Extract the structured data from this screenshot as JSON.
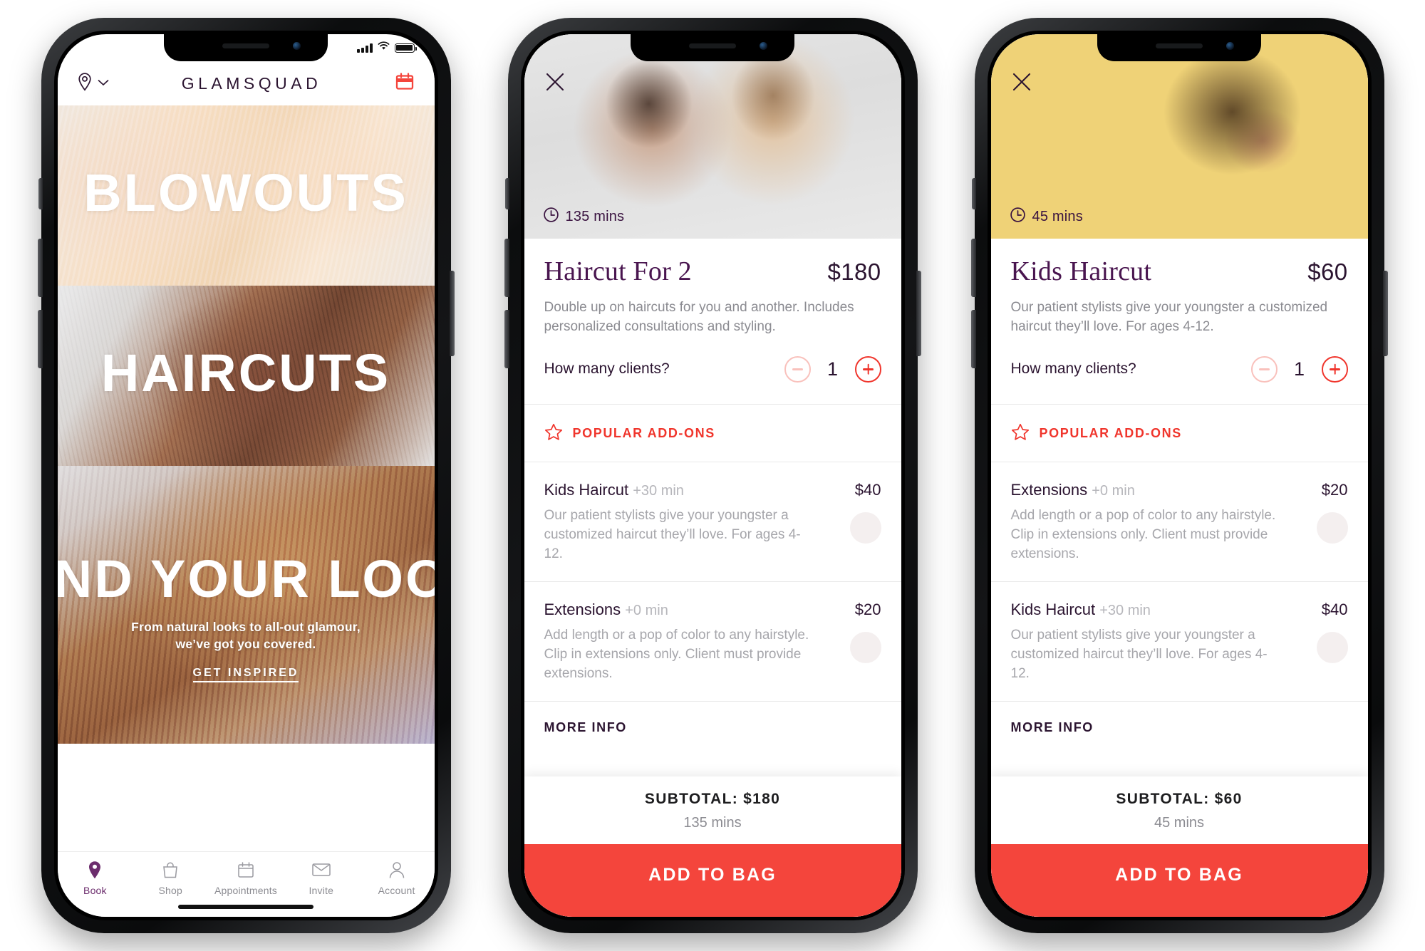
{
  "phone1": {
    "statusbar": {
      "signal_icon": "cellular-signal-icon",
      "wifi_icon": "wifi-icon",
      "battery_icon": "battery-icon"
    },
    "header": {
      "location_icon": "location-pin-icon",
      "location_chevron_icon": "chevron-down-icon",
      "brand": "GLAMSQUAD",
      "calendar_icon": "calendar-icon"
    },
    "heroes": [
      {
        "label": "BLOWOUTS",
        "name": "hero-blowouts"
      },
      {
        "label": "HAIRCUTS",
        "name": "hero-haircuts"
      },
      {
        "label": "FIND YOUR LOOK",
        "name": "hero-find-your-look",
        "subtitle": "From natural looks to all-out glamour,\nwe’ve got you covered.",
        "cta": "GET INSPIRED"
      }
    ],
    "tabbar": [
      {
        "label": "Book",
        "icon": "location-pin-icon",
        "active": true
      },
      {
        "label": "Shop",
        "icon": "shopping-bag-icon",
        "active": false
      },
      {
        "label": "Appointments",
        "icon": "calendar-icon",
        "active": false
      },
      {
        "label": "Invite",
        "icon": "envelope-icon",
        "active": false
      },
      {
        "label": "Account",
        "icon": "person-icon",
        "active": false
      }
    ]
  },
  "phone2": {
    "close_icon": "close-icon",
    "clock_icon": "clock-icon",
    "duration": "135 mins",
    "title": "Haircut For 2",
    "price": "$180",
    "description": "Double up on haircuts for you and another. Includes personalized consultations and styling.",
    "clients_label": "How many clients?",
    "minus_icon": "minus-circle-icon",
    "plus_icon": "plus-circle-icon",
    "quantity": "1",
    "addons_star_icon": "star-icon",
    "addons_heading": "POPULAR ADD-ONS",
    "addons": [
      {
        "name": "Kids Haircut",
        "mins": "+30 min",
        "price": "$40",
        "description": "Our patient stylists give your youngster a customized haircut they’ll love. For ages 4-12."
      },
      {
        "name": "Extensions",
        "mins": "+0 min",
        "price": "$20",
        "description": "Add length or a pop of color to any hairstyle. Clip in extensions only. Client must provide extensions."
      }
    ],
    "more_info": "MORE INFO",
    "subtotal": "SUBTOTAL: $180",
    "subtotal_mins": "135 mins",
    "cta": "ADD TO BAG"
  },
  "phone3": {
    "close_icon": "close-icon",
    "clock_icon": "clock-icon",
    "duration": "45 mins",
    "title": "Kids Haircut",
    "price": "$60",
    "description": "Our patient stylists give your youngster a customized haircut they’ll love. For ages 4-12.",
    "clients_label": "How many clients?",
    "minus_icon": "minus-circle-icon",
    "plus_icon": "plus-circle-icon",
    "quantity": "1",
    "addons_star_icon": "star-icon",
    "addons_heading": "POPULAR ADD-ONS",
    "addons": [
      {
        "name": "Extensions",
        "mins": "+0 min",
        "price": "$20",
        "description": "Add length or a pop of color to any hairstyle. Clip in extensions only. Client must provide extensions."
      },
      {
        "name": "Kids Haircut",
        "mins": "+30 min",
        "price": "$40",
        "description": "Our patient stylists give your youngster a customized haircut they’ll love. For ages 4-12."
      }
    ],
    "more_info": "MORE INFO",
    "subtotal": "SUBTOTAL: $60",
    "subtotal_mins": "45 mins",
    "cta": "ADD TO BAG"
  },
  "colors": {
    "brand_purple": "#49154f",
    "accent_red": "#f4453c",
    "accent_red_icon": "#f0352c",
    "muted_grey": "#8b8b91",
    "kid_hero_yellow": "#efd277",
    "tab_active_purple": "#6c2d6d"
  }
}
